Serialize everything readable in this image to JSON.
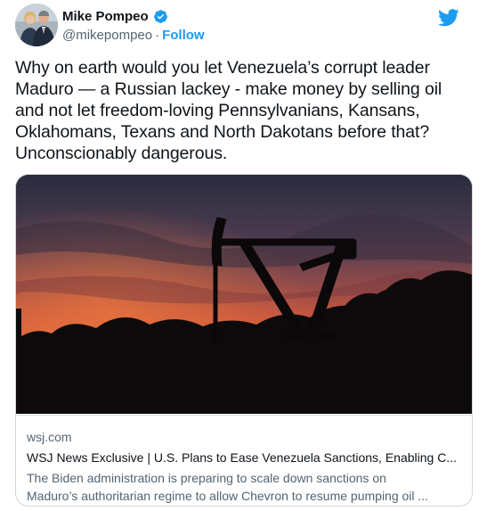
{
  "author": {
    "display_name": "Mike Pompeo",
    "handle": "@mikepompeo",
    "separator": "·",
    "follow_label": "Follow",
    "verified_icon": "verified-badge-icon",
    "avatar_icon": "avatar-photo"
  },
  "brand": {
    "logo_icon": "twitter-bird-icon",
    "accent_color": "#1d9bf0"
  },
  "tweet": {
    "lines": [
      "Why on earth would you let Venezuela’s corrupt leader",
      "Maduro — a Russian lackey - make money by selling oil",
      "and not let freedom-loving Pennsylvanians, Kansans,",
      "Oklahomans, Texans and North Dakotans before that?",
      "Unconscionably dangerous."
    ]
  },
  "link_card": {
    "image_icon": "oil-pumpjack-sunset-photo",
    "domain": "wsj.com",
    "title": "WSJ News Exclusive | U.S. Plans to Ease Venezuela Sanctions, Enabling C...",
    "description_lines": [
      "The Biden administration is preparing to scale down sanctions on",
      "Maduro’s authoritarian regime to allow Chevron to resume pumping oil ..."
    ]
  }
}
